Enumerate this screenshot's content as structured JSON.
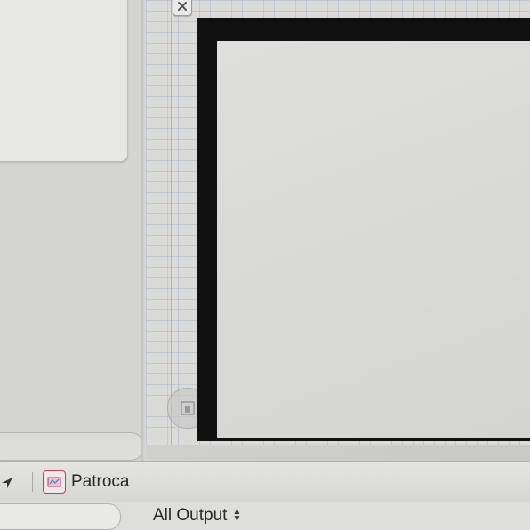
{
  "toolbar": {
    "scheme_label": "Patroca"
  },
  "output": {
    "selector_label": "All Output"
  },
  "icons": {
    "close": "close-icon",
    "zoom": "zoom-icon",
    "run_arrow": "arrow-icon",
    "scheme": "scheme-icon",
    "updown": "chevron-updown-icon"
  },
  "colors": {
    "device_frame": "#111111",
    "canvas_grid": "#96aac3",
    "scheme_icon_border": "#c0405a"
  }
}
